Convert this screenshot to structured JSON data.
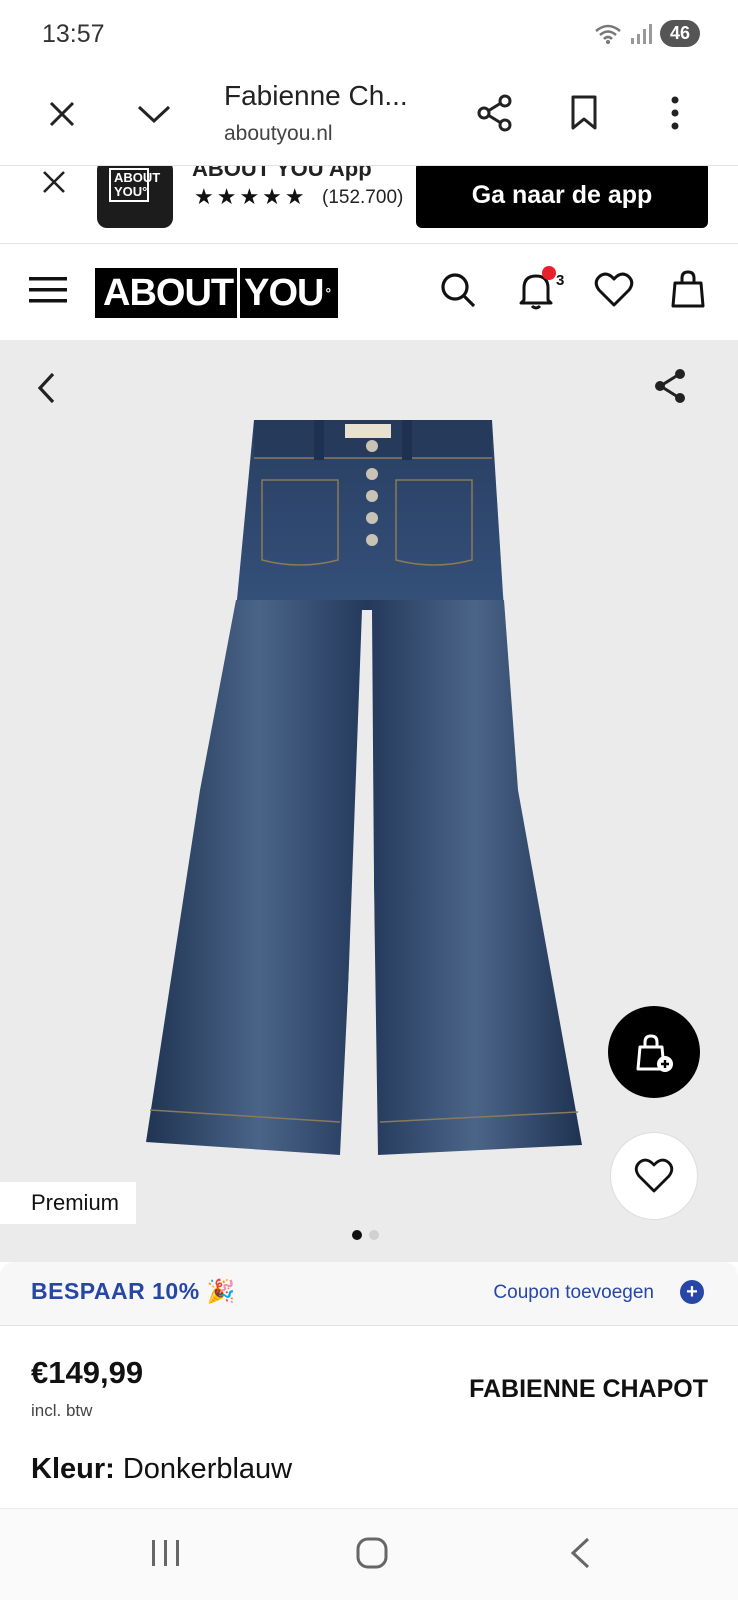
{
  "status_bar": {
    "time": "13:57",
    "battery": "46"
  },
  "custom_tab": {
    "title": "Fabienne Ch...",
    "url": "aboutyou.nl"
  },
  "app_banner": {
    "app_name": "ABOUT YOU App",
    "logo_text": "ABOUT YOU°",
    "stars": "★★★★★",
    "rating_count": "(152.700)",
    "button_label": "Ga naar de app"
  },
  "header": {
    "logo_left": "ABOUT",
    "logo_right": "YOU",
    "logo_mark": "°",
    "notification_count": "3"
  },
  "gallery": {
    "premium_label": "Premium",
    "image_count": 2,
    "active_index": 0
  },
  "coupon": {
    "save_text": "BESPAAR 10% 🎉",
    "add_label": "Coupon toevoegen",
    "plus": "+"
  },
  "product": {
    "price": "€149,99",
    "vat": "incl. btw",
    "brand": "FABIENNE CHAPOT",
    "color_label": "Kleur:",
    "color_value": "Donkerblauw"
  },
  "colors": {
    "accent_blue": "#2746a5",
    "notification_red": "#e8202c",
    "denim": "#2c3f5f"
  }
}
